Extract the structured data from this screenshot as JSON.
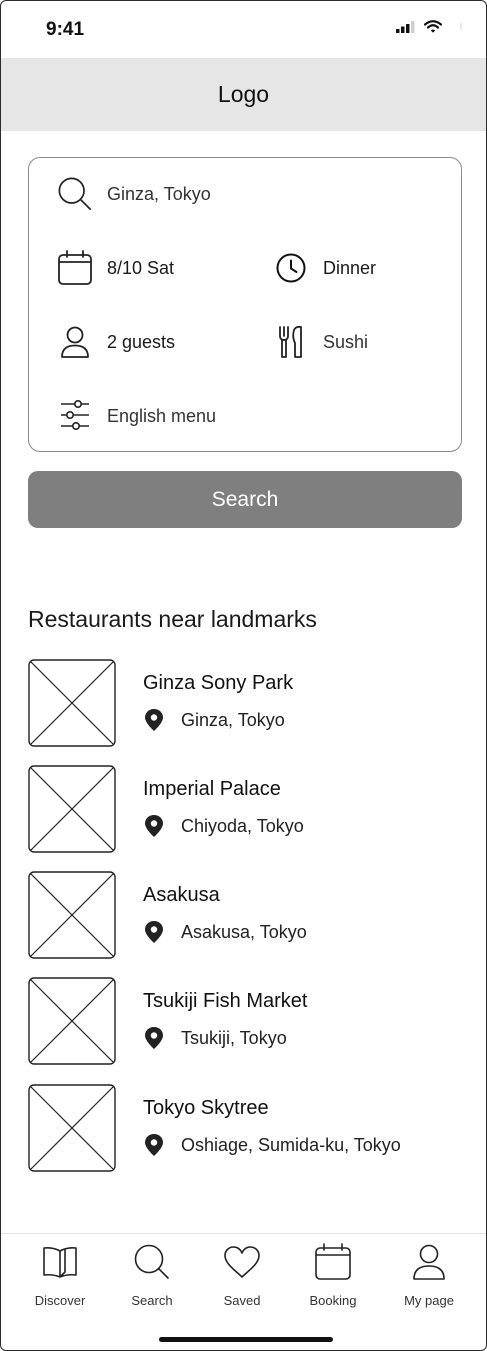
{
  "status_bar": {
    "time": "9:41",
    "icons": [
      "cellular-signal-icon",
      "wifi-icon",
      "battery-icon"
    ]
  },
  "header": {
    "logo": "Logo"
  },
  "search_form": {
    "location": {
      "icon": "search-icon",
      "value": "Ginza, Tokyo"
    },
    "date": {
      "icon": "calendar-icon",
      "value": "8/10 Sat"
    },
    "time": {
      "icon": "clock-icon",
      "value": "Dinner"
    },
    "guests": {
      "icon": "person-icon",
      "value": "2 guests"
    },
    "cuisine": {
      "icon": "utensils-icon",
      "value": "Sushi"
    },
    "filter": {
      "icon": "sliders-icon",
      "value": "English menu"
    },
    "search_label": "Search"
  },
  "landmarks": {
    "title": "Restaurants near landmarks",
    "items": [
      {
        "name": "Ginza Sony Park",
        "location": "Ginza, Tokyo"
      },
      {
        "name": "Imperial Palace",
        "location": "Chiyoda, Tokyo"
      },
      {
        "name": "Asakusa",
        "location": "Asakusa, Tokyo"
      },
      {
        "name": "Tsukiji Fish Market",
        "location": "Tsukiji, Tokyo"
      },
      {
        "name": "Tokyo Skytree",
        "location": "Oshiage, Sumida-ku, Tokyo"
      }
    ]
  },
  "bottom_nav": {
    "items": [
      {
        "label": "Discover",
        "icon": "book-icon"
      },
      {
        "label": "Search",
        "icon": "search-icon"
      },
      {
        "label": "Saved",
        "icon": "heart-icon"
      },
      {
        "label": "Booking",
        "icon": "calendar-icon"
      },
      {
        "label": "My page",
        "icon": "person-icon"
      }
    ]
  }
}
